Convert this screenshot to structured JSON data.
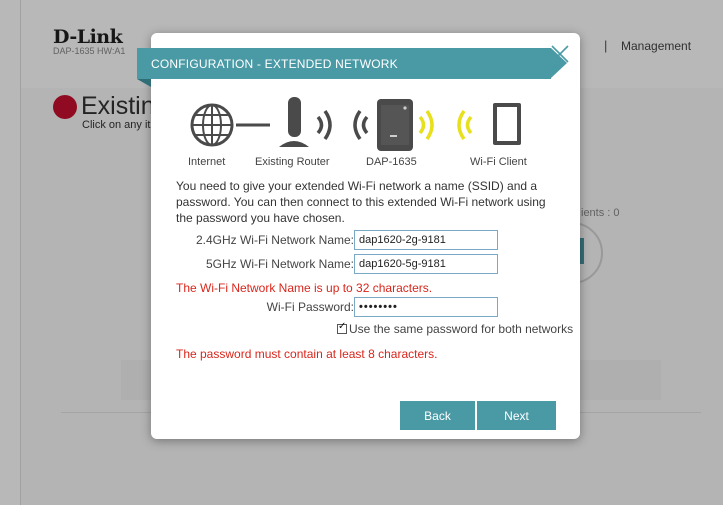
{
  "background": {
    "brand": "D-Link",
    "model": "DAP-1635   HW:A1",
    "menu_separator": "|",
    "menu_management": "Management",
    "page_heading": "Existing",
    "page_hint": "Click on any it",
    "clients_label": "ients : 0"
  },
  "modal": {
    "title": "CONFIGURATION - EXTENDED NETWORK",
    "diagram": {
      "internet_label": "Internet",
      "router_label": "Existing Router",
      "extender_label": "DAP-1635",
      "client_label": "Wi-Fi Client"
    },
    "intro_text": "You need to give your extended Wi-Fi network a name (SSID) and a password. You can then connect to this extended Wi-Fi network using the password you have chosen.",
    "ssid_24_label": "2.4GHz Wi-Fi Network Name:",
    "ssid_24_value": "dap1620-2g-9181",
    "ssid_5_label": "5GHz Wi-Fi Network Name:",
    "ssid_5_value": "dap1620-5g-9181",
    "ssid_error": "The Wi-Fi Network Name is up to 32 characters.",
    "password_label": "Wi-Fi Password:",
    "password_value": "••••••••",
    "same_password_label": "Use the same password for both networks",
    "same_password_checked": true,
    "password_error": "The password must contain at least 8 characters.",
    "back_label": "Back",
    "next_label": "Next"
  },
  "colors": {
    "accent": "#4a9aa6",
    "error": "#d9261c",
    "status_dot": "#c8102e",
    "signal_gray": "#4a4a4a",
    "signal_yellow": "#e8e01c"
  },
  "icons": [
    "globe-icon",
    "router-icon",
    "extender-icon",
    "tablet-icon",
    "close-icon",
    "checkbox-icon"
  ]
}
